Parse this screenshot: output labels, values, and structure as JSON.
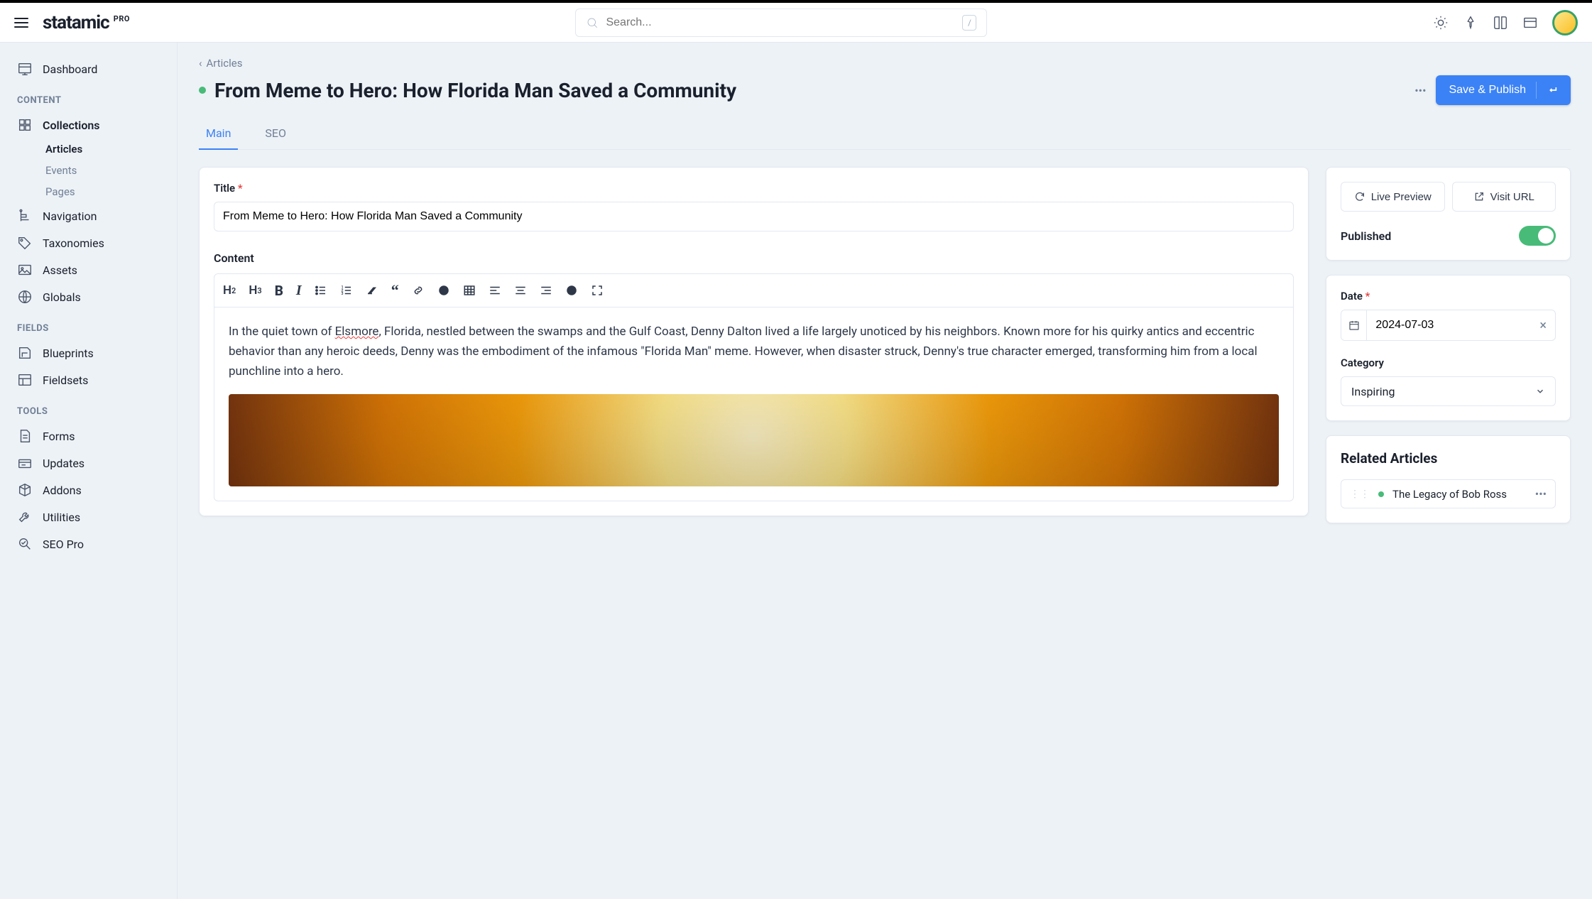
{
  "logo": {
    "text": "statamic",
    "badge": "PRO"
  },
  "search": {
    "placeholder": "Search...",
    "key": "/"
  },
  "sidebar": {
    "dashboard": "Dashboard",
    "sections": {
      "content": {
        "label": "CONTENT",
        "collections": "Collections",
        "sub": {
          "articles": "Articles",
          "events": "Events",
          "pages": "Pages"
        },
        "navigation": "Navigation",
        "taxonomies": "Taxonomies",
        "assets": "Assets",
        "globals": "Globals"
      },
      "fields": {
        "label": "FIELDS",
        "blueprints": "Blueprints",
        "fieldsets": "Fieldsets"
      },
      "tools": {
        "label": "TOOLS",
        "forms": "Forms",
        "updates": "Updates",
        "addons": "Addons",
        "utilities": "Utilities",
        "seopro": "SEO Pro"
      }
    }
  },
  "breadcrumb": {
    "label": "Articles"
  },
  "entry": {
    "title": "From Meme to Hero: How Florida Man Saved a Community",
    "tabs": {
      "main": "Main",
      "seo": "SEO"
    },
    "fields": {
      "title_label": "Title",
      "title_value": "From Meme to Hero: How Florida Man Saved a Community",
      "content_label": "Content",
      "content_p1a": "In the quiet town of ",
      "content_elsmore": "Elsmore",
      "content_p1b": ", Florida, nestled between the swamps and the Gulf Coast, Denny Dalton lived a life largely unoticed by his neighbors. Known more for his quirky antics and eccentric behavior than any heroic deeds, Denny was the embodiment of the infamous \"Florida Man\" meme. However, when disaster struck, Denny's true character emerged, transforming him from a local punchline into a hero."
    }
  },
  "actions": {
    "save": "Save & Publish",
    "live_preview": "Live Preview",
    "visit_url": "Visit URL",
    "published_label": "Published"
  },
  "meta": {
    "date_label": "Date",
    "date_value": "2024-07-03",
    "category_label": "Category",
    "category_value": "Inspiring"
  },
  "related": {
    "title": "Related Articles",
    "items": [
      {
        "title": "The Legacy of Bob Ross"
      }
    ]
  }
}
